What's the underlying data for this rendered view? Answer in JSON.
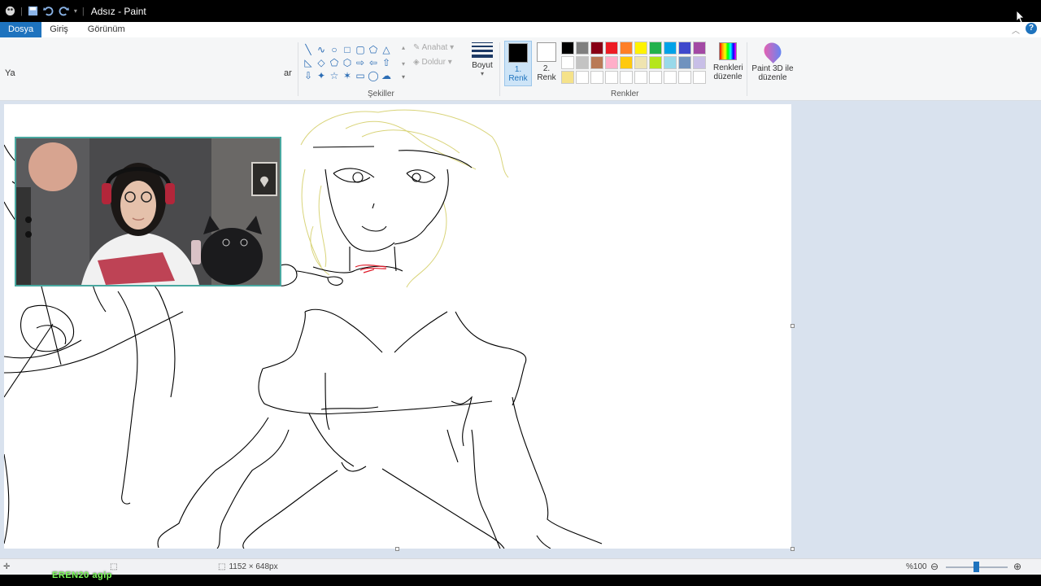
{
  "window": {
    "title": "Adsız - Paint"
  },
  "menu": {
    "tabs": [
      "Dosya",
      "Giriş",
      "Görünüm"
    ],
    "help_glyph": "?"
  },
  "ribbon": {
    "clipped_label_left": "Ya",
    "clipped_label_right": "ar",
    "shapes_group_label": "Şekiller",
    "outline_label": "Anahat",
    "fill_label": "Doldur",
    "size_label": "Boyut",
    "color1_label": [
      "1.",
      "Renk"
    ],
    "color2_label": [
      "2.",
      "Renk"
    ],
    "colors_group_label": "Renkler",
    "edit_colors_label": [
      "Renkleri",
      "düzenle"
    ],
    "paint3d_label": [
      "Paint 3D ile",
      "düzenle"
    ],
    "shape_icons": [
      "line",
      "curve",
      "oval",
      "rectangle",
      "rounded-rect",
      "polygon",
      "triangle",
      "right-triangle",
      "diamond",
      "pentagon",
      "hexagon",
      "arrow-right",
      "arrow-left",
      "arrow-up",
      "arrow-down",
      "star-4",
      "star-5",
      "star-6",
      "callout-rect",
      "callout-oval",
      "callout-cloud"
    ],
    "shape_glyphs": [
      "╲",
      "∿",
      "○",
      "□",
      "▢",
      "⬠",
      "△",
      "◺",
      "◇",
      "⬠",
      "⬡",
      "⇨",
      "⇦",
      "⇧",
      "⇩",
      "✦",
      "☆",
      "✶",
      "▭",
      "◯",
      "☁"
    ],
    "color1": "#000000",
    "color2": "#ffffff",
    "palette": [
      "#000000",
      "#7f7f7f",
      "#880015",
      "#ed1c24",
      "#ff7f27",
      "#fff200",
      "#22b14c",
      "#00a2e8",
      "#3f48cc",
      "#a349a4",
      "#ffffff",
      "#c3c3c3",
      "#b97a57",
      "#ffaec9",
      "#ffc90e",
      "#efe4b0",
      "#b5e61d",
      "#99d9ea",
      "#7092be",
      "#c8bfe7",
      "#f5e28a",
      "#ffffff",
      "#ffffff",
      "#ffffff",
      "#ffffff",
      "#ffffff",
      "#ffffff",
      "#ffffff",
      "#ffffff",
      "#ffffff"
    ]
  },
  "status": {
    "canvas_size": "1152 × 648px",
    "zoom": "%100"
  },
  "overlay": {
    "stream_text": "EREN20 agip"
  }
}
